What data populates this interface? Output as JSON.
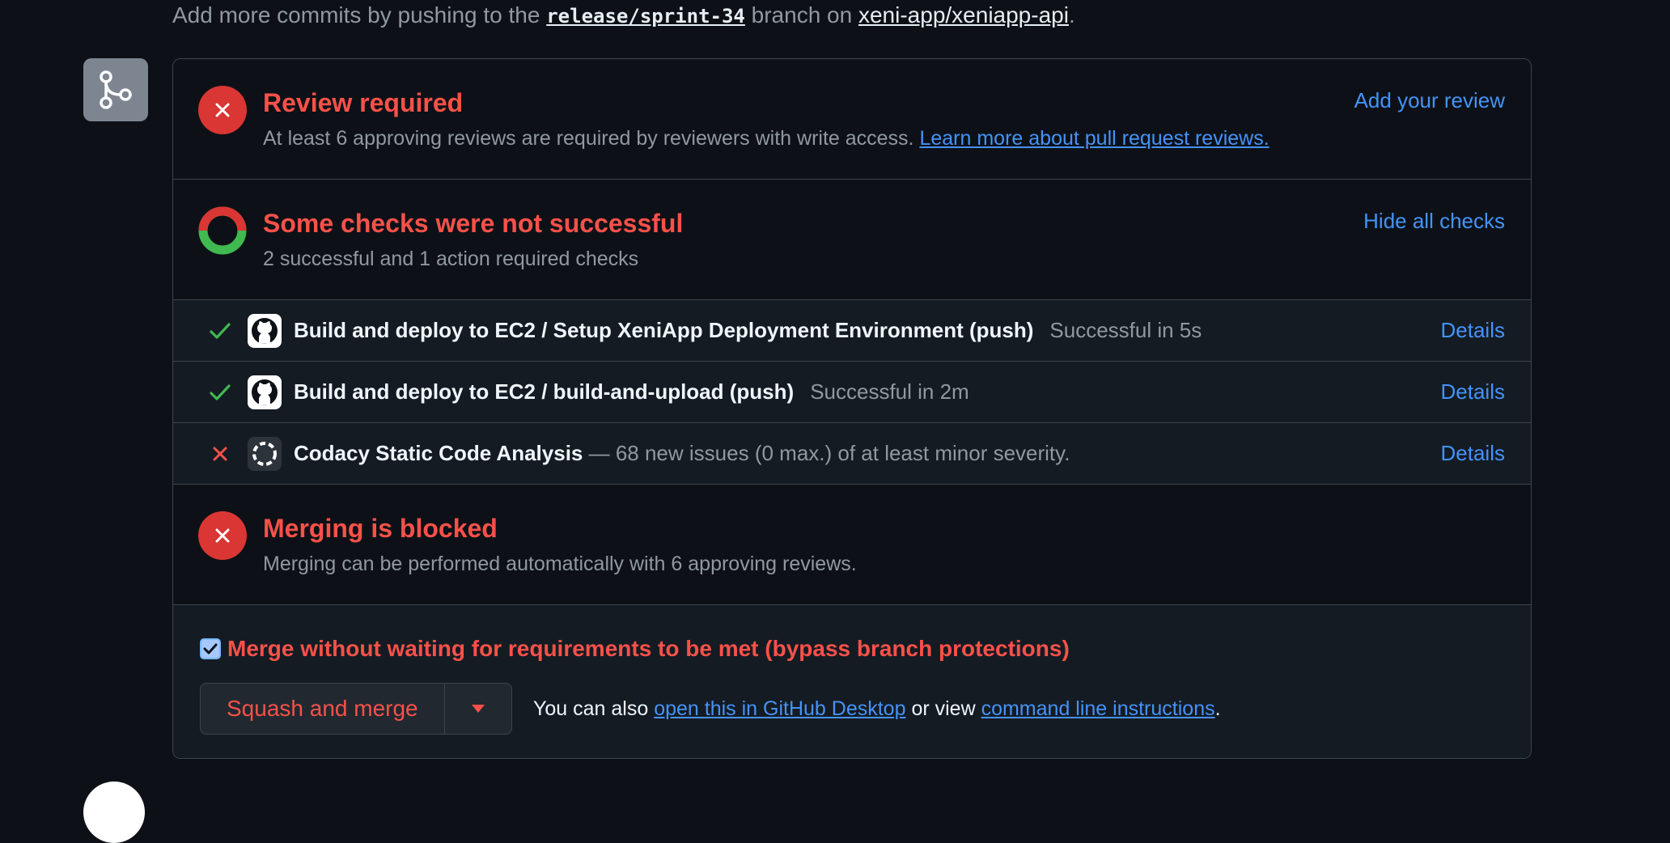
{
  "header": {
    "prefix": "Add more commits by pushing to the",
    "branch": "release/sprint-34",
    "middle": "branch on",
    "repo": "xeni-app/xeniapp-api",
    "suffix": "."
  },
  "review": {
    "title": "Review required",
    "description": "At least 6 approving reviews are required by reviewers with write access.",
    "learn_link": "Learn more about pull request reviews.",
    "action": "Add your review"
  },
  "checks": {
    "title": "Some checks were not successful",
    "summary": "2 successful and 1 action required checks",
    "action": "Hide all checks",
    "items": [
      {
        "status": "success",
        "name": "Build and deploy to EC2 / Setup XeniApp Deployment Environment (push)",
        "meta": "Successful in 5s",
        "details": "Details"
      },
      {
        "status": "success",
        "name": "Build and deploy to EC2 / build-and-upload (push)",
        "meta": "Successful in 2m",
        "details": "Details"
      },
      {
        "status": "failure",
        "name": "Codacy Static Code Analysis",
        "meta": "— 68 new issues (0 max.) of at least minor severity.",
        "details": "Details"
      }
    ]
  },
  "blocked": {
    "title": "Merging is blocked",
    "description": "Merging can be performed automatically with 6 approving reviews."
  },
  "merge": {
    "bypass_label": "Merge without waiting for requirements to be met (bypass branch protections)",
    "bypass_checked": true,
    "button": "Squash and merge",
    "hint_prefix": "You can also",
    "desktop_link": "open this in GitHub Desktop",
    "hint_middle": "or view",
    "cli_link": "command line instructions",
    "hint_suffix": "."
  },
  "colors": {
    "background": "#0d1117",
    "danger": "#f85149",
    "success": "#3fb950",
    "link": "#4493f8",
    "muted": "#9198a1"
  },
  "icons": {
    "merge": "git-merge-icon",
    "error": "x-circle-icon",
    "partial": "donut-status-icon",
    "check": "check-icon",
    "github": "github-logo-icon",
    "codacy": "codacy-logo-icon",
    "caret": "triangle-down-icon"
  }
}
